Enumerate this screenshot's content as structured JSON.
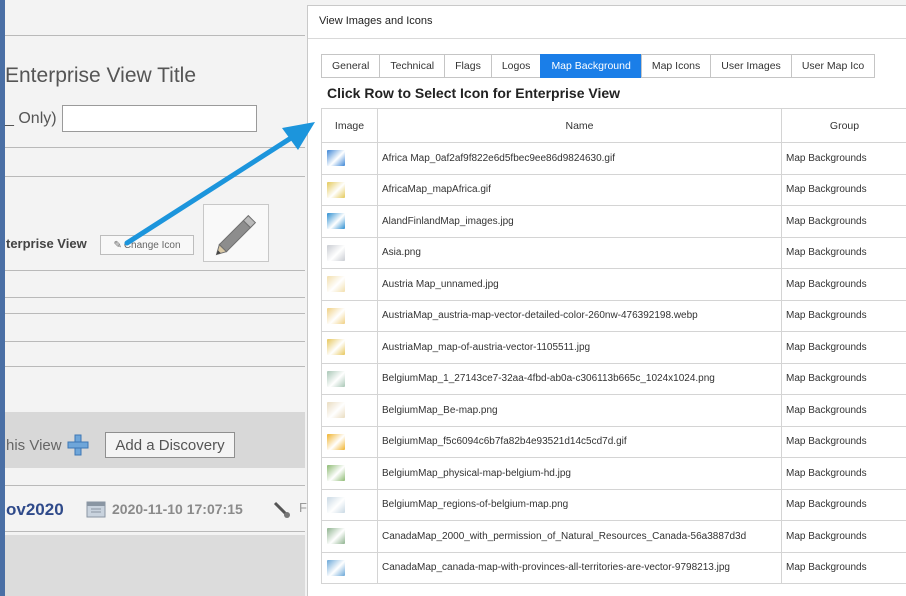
{
  "background_page": {
    "title": "Enterprise View Title",
    "only_label": "_ Only)",
    "enterprise_view_label": "terprise View",
    "change_icon_label": "Change Icon",
    "this_view_label": "his View",
    "add_discovery_label": "Add a Discovery",
    "record_label": "ov2020",
    "record_date": "2020-11-10 17:07:15",
    "trailing_char": "F"
  },
  "dialog": {
    "title": "View Images and Icons",
    "tabs": [
      {
        "label": "General",
        "active": false
      },
      {
        "label": "Technical",
        "active": false
      },
      {
        "label": "Flags",
        "active": false
      },
      {
        "label": "Logos",
        "active": false
      },
      {
        "label": "Map Background",
        "active": true
      },
      {
        "label": "Map Icons",
        "active": false
      },
      {
        "label": "User Images",
        "active": false
      },
      {
        "label": "User Map Ico",
        "active": false
      }
    ],
    "instruction": "Click Row to Select Icon for Enterprise View",
    "columns": {
      "image": "Image",
      "name": "Name",
      "group": "Group"
    },
    "rows": [
      {
        "name": "Africa Map_0af2af9f822e6d5fbec9ee86d9824630.gif",
        "group": "Map Backgrounds",
        "thumb": "#3d86d6"
      },
      {
        "name": "AfricaMap_mapAfrica.gif",
        "group": "Map Backgrounds",
        "thumb": "#e4c95a"
      },
      {
        "name": "AlandFinlandMap_images.jpg",
        "group": "Map Backgrounds",
        "thumb": "#2e8fd1"
      },
      {
        "name": "Asia.png",
        "group": "Map Backgrounds",
        "thumb": "#c9ccd2"
      },
      {
        "name": "Austria Map_unnamed.jpg",
        "group": "Map Backgrounds",
        "thumb": "#f2dfad"
      },
      {
        "name": "AustriaMap_austria-map-vector-detailed-color-260nw-476392198.webp",
        "group": "Map Backgrounds",
        "thumb": "#f0d083"
      },
      {
        "name": "AustriaMap_map-of-austria-vector-1105511.jpg",
        "group": "Map Backgrounds",
        "thumb": "#e7c75c"
      },
      {
        "name": "BelgiumMap_1_27143ce7-32aa-4fbd-ab0a-c306113b665c_1024x1024.png",
        "group": "Map Backgrounds",
        "thumb": "#a9c7b6"
      },
      {
        "name": "BelgiumMap_Be-map.png",
        "group": "Map Backgrounds",
        "thumb": "#e9dcc0"
      },
      {
        "name": "BelgiumMap_f5c6094c6b7fa82b4e93521d14c5cd7d.gif",
        "group": "Map Backgrounds",
        "thumb": "#f0b32e"
      },
      {
        "name": "BelgiumMap_physical-map-belgium-hd.jpg",
        "group": "Map Backgrounds",
        "thumb": "#8dbb73"
      },
      {
        "name": "BelgiumMap_regions-of-belgium-map.png",
        "group": "Map Backgrounds",
        "thumb": "#c9d9e4"
      },
      {
        "name": "CanadaMap_2000_with_permission_of_Natural_Resources_Canada-56a3887d3d",
        "group": "Map Backgrounds",
        "thumb": "#8fb38f"
      },
      {
        "name": "CanadaMap_canada-map-with-provinces-all-territories-are-vector-9798213.jpg",
        "group": "Map Backgrounds",
        "thumb": "#6aa7d8"
      }
    ]
  },
  "colors": {
    "accent_tab": "#1a7ee8",
    "arrow": "#1c95dc",
    "record_link": "#2f4a8a"
  }
}
